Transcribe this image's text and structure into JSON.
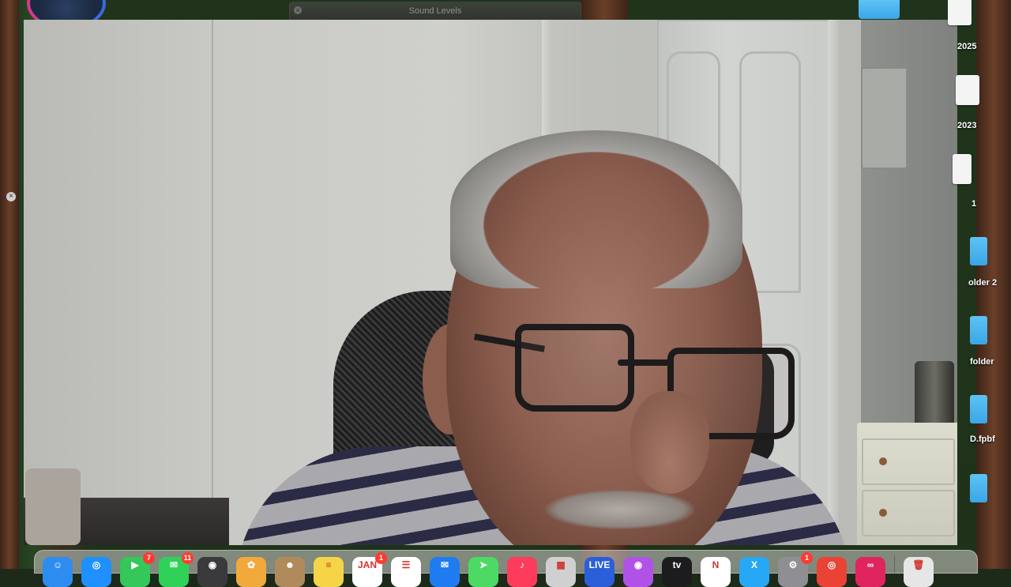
{
  "sound_window": {
    "title": "Sound Levels"
  },
  "desktop_icons": [
    {
      "label": "2025",
      "kind": "doc"
    },
    {
      "label": "2023",
      "kind": "doc"
    },
    {
      "label": "1",
      "kind": "doc"
    },
    {
      "label": "older 2",
      "kind": "folder"
    },
    {
      "label": "folder",
      "kind": "folder"
    },
    {
      "label": "D.fpbf",
      "kind": "folder"
    },
    {
      "label": "",
      "kind": "folder"
    }
  ],
  "dock": {
    "apps": [
      {
        "name": "finder",
        "color": "#2d8cf0",
        "glyph": "☺",
        "badge": ""
      },
      {
        "name": "safari",
        "color": "#1e90ff",
        "glyph": "◎",
        "badge": ""
      },
      {
        "name": "facetime",
        "color": "#34c759",
        "glyph": "▶",
        "badge": "7"
      },
      {
        "name": "messages",
        "color": "#30d158",
        "glyph": "✉",
        "badge": "11"
      },
      {
        "name": "quicktime",
        "color": "#3a3a3c",
        "glyph": "◉",
        "badge": ""
      },
      {
        "name": "photos",
        "color": "#f2a93b",
        "glyph": "✿",
        "badge": ""
      },
      {
        "name": "contacts",
        "color": "#b08a5a",
        "glyph": "☻",
        "badge": ""
      },
      {
        "name": "notes",
        "color": "#f5d547",
        "glyph": "≡",
        "badge": ""
      },
      {
        "name": "calendar",
        "color": "#ffffff",
        "glyph": "JAN",
        "badge": "1"
      },
      {
        "name": "reminders",
        "color": "#ffffff",
        "glyph": "☰",
        "badge": ""
      },
      {
        "name": "mail",
        "color": "#1f7cf0",
        "glyph": "✉",
        "badge": ""
      },
      {
        "name": "maps",
        "color": "#4cd964",
        "glyph": "➤",
        "badge": ""
      },
      {
        "name": "music",
        "color": "#fc3c5a",
        "glyph": "♪",
        "badge": ""
      },
      {
        "name": "launchpad",
        "color": "#d0d0d0",
        "glyph": "▦",
        "badge": ""
      },
      {
        "name": "live",
        "color": "#2b5fd9",
        "glyph": "LIVE",
        "badge": ""
      },
      {
        "name": "podcasts",
        "color": "#b052e8",
        "glyph": "◉",
        "badge": ""
      },
      {
        "name": "tv",
        "color": "#1c1c1e",
        "glyph": "tv",
        "badge": ""
      },
      {
        "name": "news",
        "color": "#ffffff",
        "glyph": "N",
        "badge": ""
      },
      {
        "name": "xcode",
        "color": "#27a8f5",
        "glyph": "X",
        "badge": ""
      },
      {
        "name": "system-settings",
        "color": "#8e8e93",
        "glyph": "⚙",
        "badge": "1"
      },
      {
        "name": "chrome",
        "color": "#ea4335",
        "glyph": "◎",
        "badge": ""
      },
      {
        "name": "creative-cloud",
        "color": "#e0245e",
        "glyph": "∞",
        "badge": ""
      },
      {
        "name": "trash",
        "color": "#e6e6e6",
        "glyph": "🗑",
        "badge": ""
      }
    ]
  }
}
